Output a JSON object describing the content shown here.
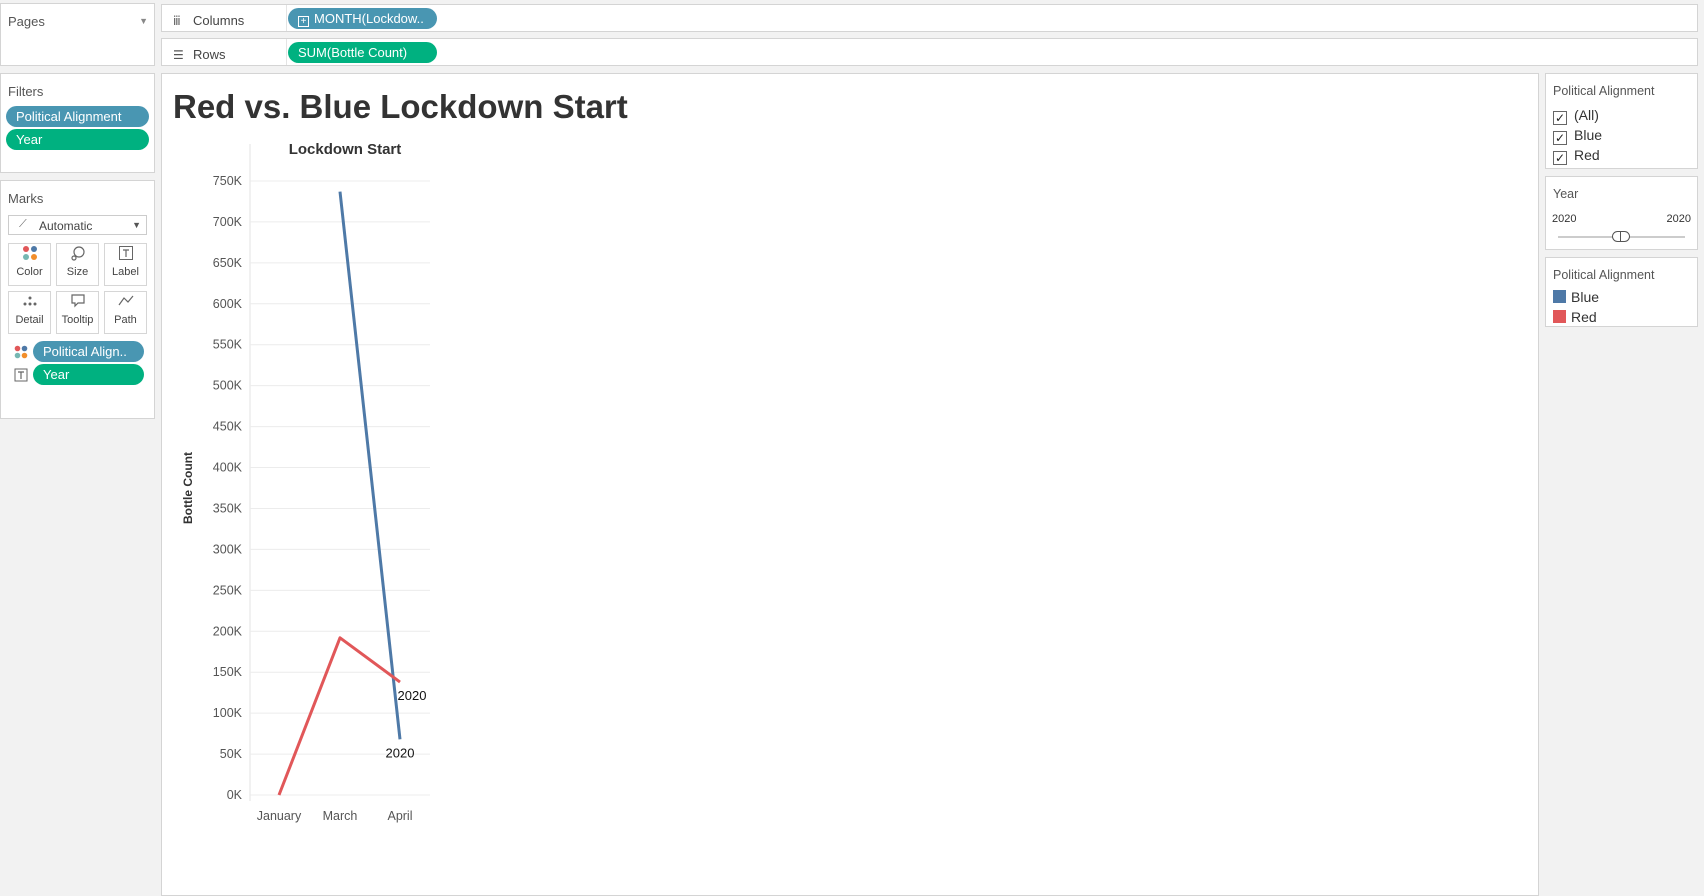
{
  "pages": {
    "title": "Pages"
  },
  "filters": {
    "title": "Filters",
    "pills": [
      "Political Alignment",
      "Year"
    ]
  },
  "marks": {
    "title": "Marks",
    "type": "Automatic",
    "buttons": [
      "Color",
      "Size",
      "Label",
      "Detail",
      "Tooltip",
      "Path"
    ],
    "pills": [
      "Political Align..",
      "Year"
    ]
  },
  "shelves": {
    "columns_label": "Columns",
    "columns_pill": "MONTH(Lockdow..",
    "rows_label": "Rows",
    "rows_pill": "SUM(Bottle Count)"
  },
  "sheet": {
    "title": "Red vs. Blue Lockdown Start"
  },
  "right_panel": {
    "filter1": {
      "title": "Political Alignment",
      "options": [
        "(All)",
        "Blue",
        "Red"
      ]
    },
    "year": {
      "title": "Year",
      "min": "2020",
      "max": "2020"
    },
    "legend": {
      "title": "Political Alignment",
      "items": [
        {
          "label": "Blue",
          "color": "#4e79a7"
        },
        {
          "label": "Red",
          "color": "#e15759"
        }
      ]
    }
  },
  "chart_data": {
    "type": "line",
    "title": "Lockdown Start",
    "xlabel": "",
    "ylabel": "Bottle Count",
    "categories": [
      "January",
      "March",
      "April"
    ],
    "ylim": [
      0,
      750000
    ],
    "yticks": [
      "0K",
      "50K",
      "100K",
      "150K",
      "200K",
      "250K",
      "300K",
      "350K",
      "400K",
      "450K",
      "500K",
      "550K",
      "600K",
      "650K",
      "700K",
      "750K"
    ],
    "grid": true,
    "series": [
      {
        "name": "Blue",
        "color": "#4e79a7",
        "x": [
          "March",
          "April"
        ],
        "values": [
          737000,
          68000
        ],
        "end_label": "2020"
      },
      {
        "name": "Red",
        "color": "#e15759",
        "x": [
          "January",
          "March",
          "April"
        ],
        "values": [
          0,
          192000,
          138000
        ],
        "end_label": "2020"
      }
    ]
  }
}
